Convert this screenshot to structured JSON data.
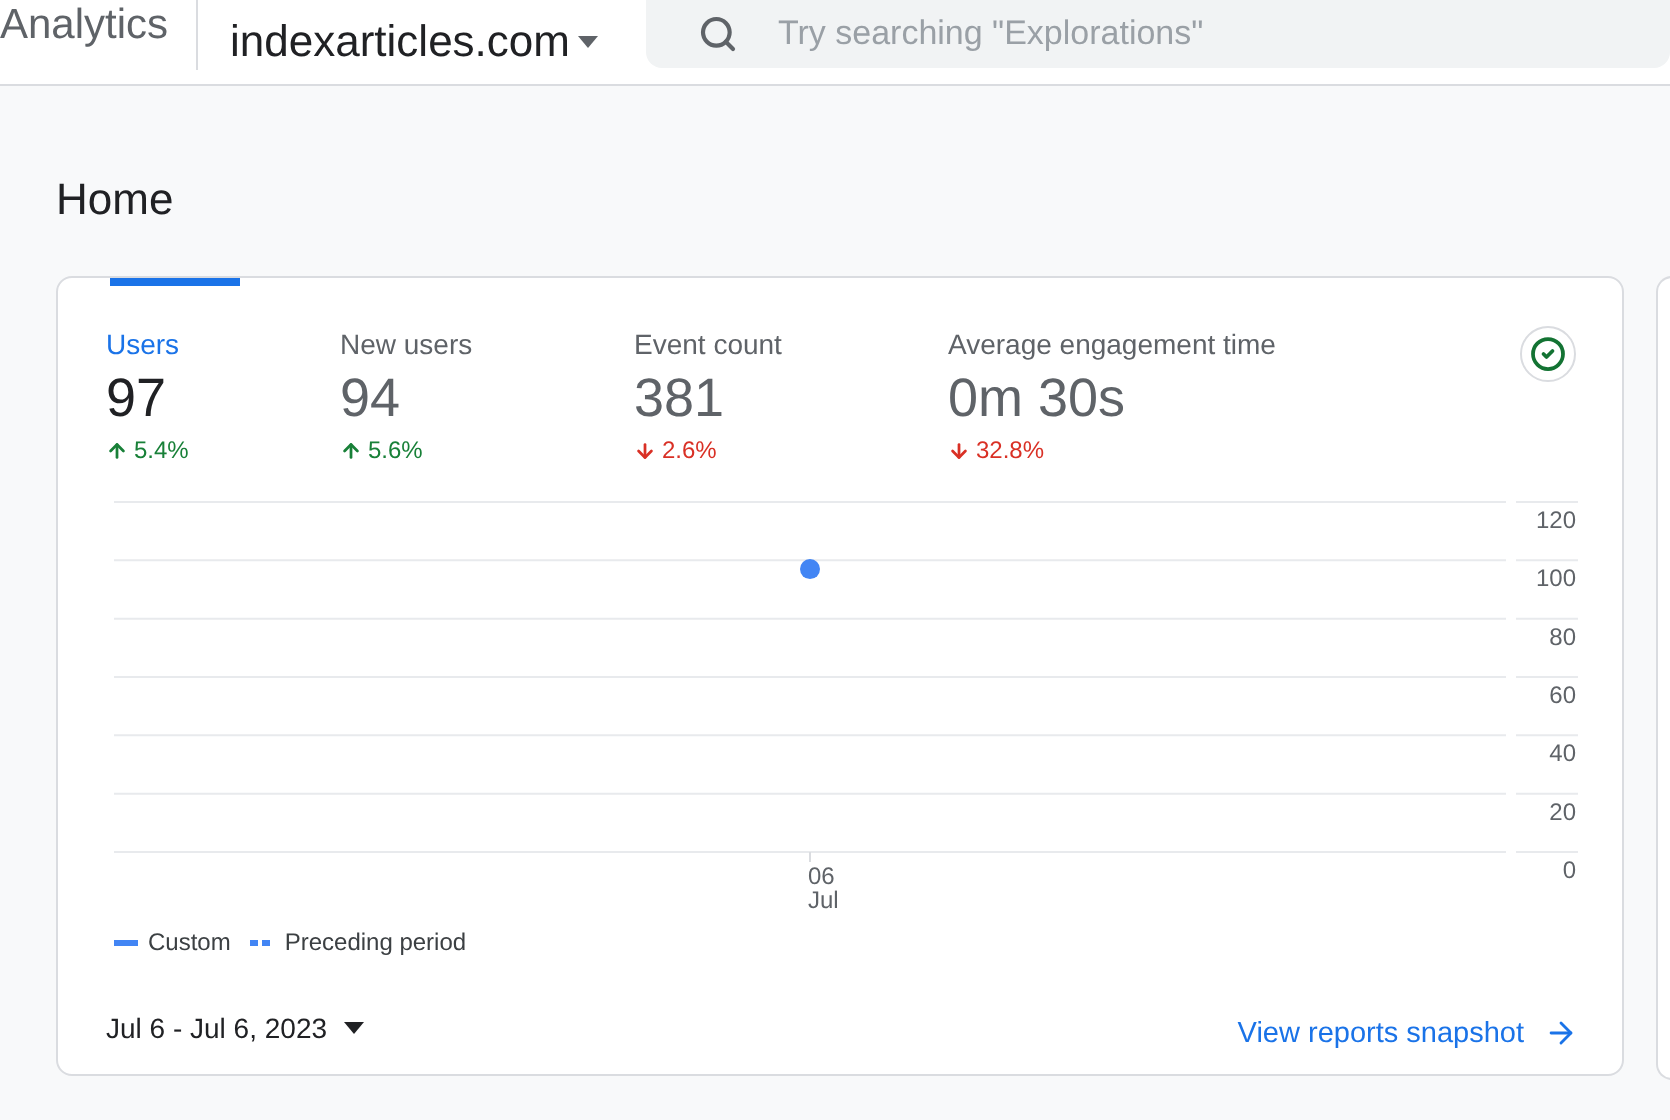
{
  "header": {
    "product": "Analytics",
    "property": "indexarticles.com",
    "search": {
      "placeholder": "Try searching \"Explorations\""
    }
  },
  "page": {
    "title": "Home"
  },
  "card": {
    "metrics": [
      {
        "label": "Users",
        "value": "97",
        "change": "5.4%",
        "increase": true,
        "selected": true
      },
      {
        "label": "New users",
        "value": "94",
        "change": "5.6%",
        "increase": true,
        "selected": false
      },
      {
        "label": "Event count",
        "value": "381",
        "change": "2.6%",
        "increase": false,
        "selected": false
      },
      {
        "label": "Average engagement time",
        "value": "0m 30s",
        "change": "32.8%",
        "increase": false,
        "selected": false
      }
    ],
    "chart_data": {
      "type": "scatter",
      "categories": [
        "06 Jul"
      ],
      "ylim": [
        0,
        120
      ],
      "grid": true,
      "yticks": [
        0,
        20,
        40,
        60,
        80,
        100,
        120
      ],
      "series": [
        {
          "name": "Custom",
          "color": "#4285f4",
          "values": [
            97
          ]
        }
      ]
    },
    "legend": [
      {
        "label": "Preceding period",
        "kind": "dashed"
      }
    ],
    "date_range": "Jul 6 - Jul 6, 2023",
    "link": "View reports snapshot"
  }
}
